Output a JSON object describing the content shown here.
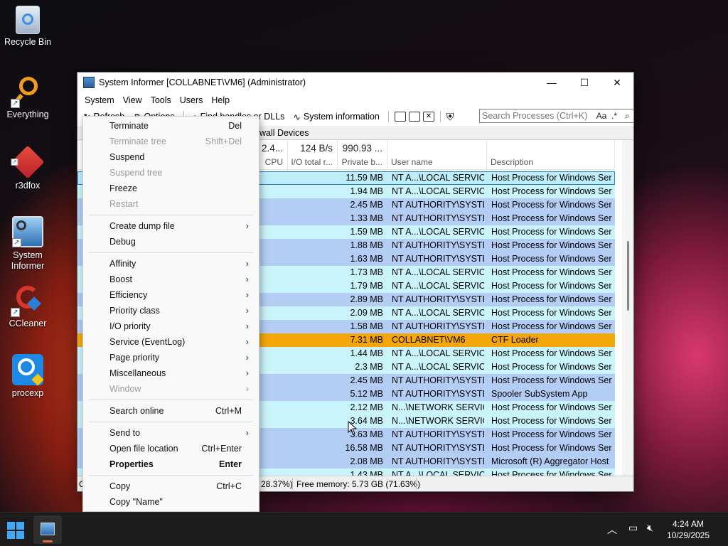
{
  "desktop": {
    "icons": [
      {
        "label": "Recycle Bin"
      },
      {
        "label": "Everything"
      },
      {
        "label": "r3dfox"
      },
      {
        "label": "System\nInformer"
      },
      {
        "label": "CCleaner"
      },
      {
        "label": "procexp"
      }
    ]
  },
  "window": {
    "title": "System Informer [COLLABNET\\VM6] (Administrator)",
    "menu": [
      "System",
      "View",
      "Tools",
      "Users",
      "Help"
    ],
    "toolbar": {
      "refresh": "Refresh",
      "options": "Options",
      "find": "Find handles or DLLs",
      "sysinfo": "System information"
    },
    "search_placeholder": "Search Processes (Ctrl+K)",
    "search_case": "Aa",
    "search_regex": ".*",
    "tabs": [
      "wall",
      "Devices"
    ],
    "columns": {
      "cpu": {
        "summary": "2.4...",
        "name": "CPU"
      },
      "io": {
        "summary": "124 B/s",
        "name": "I/O total r..."
      },
      "private": {
        "summary": "990.93 ...",
        "name": "Private b..."
      },
      "user": {
        "name": "User name"
      },
      "desc": {
        "name": "Description"
      }
    },
    "rows": [
      {
        "priv": "11.59 MB",
        "user": "NT A...\\LOCAL SERVICE",
        "desc": "Host Process for Windows Ser...",
        "bg": "#bfeefb"
      },
      {
        "priv": "1.94 MB",
        "user": "NT A...\\LOCAL SERVICE",
        "desc": "Host Process for Windows Ser...",
        "bg": "#c9f4fb"
      },
      {
        "priv": "2.45 MB",
        "user": "NT AUTHORITY\\SYSTEM",
        "desc": "Host Process for Windows Ser...",
        "bg": "#b3cdf5"
      },
      {
        "priv": "1.33 MB",
        "user": "NT AUTHORITY\\SYSTEM",
        "desc": "Host Process for Windows Ser...",
        "bg": "#b3cdf5"
      },
      {
        "priv": "1.59 MB",
        "user": "NT A...\\LOCAL SERVICE",
        "desc": "Host Process for Windows Ser...",
        "bg": "#c9f4fb"
      },
      {
        "priv": "1.88 MB",
        "user": "NT AUTHORITY\\SYSTEM",
        "desc": "Host Process for Windows Ser...",
        "bg": "#b3cdf5"
      },
      {
        "priv": "1.63 MB",
        "user": "NT AUTHORITY\\SYSTEM",
        "desc": "Host Process for Windows Ser...",
        "bg": "#b3cdf5"
      },
      {
        "priv": "1.73 MB",
        "user": "NT A...\\LOCAL SERVICE",
        "desc": "Host Process for Windows Ser...",
        "bg": "#c9f4fb"
      },
      {
        "priv": "1.79 MB",
        "user": "NT A...\\LOCAL SERVICE",
        "desc": "Host Process for Windows Ser...",
        "bg": "#c9f4fb"
      },
      {
        "priv": "2.89 MB",
        "user": "NT AUTHORITY\\SYSTEM",
        "desc": "Host Process for Windows Ser...",
        "bg": "#b3cdf5"
      },
      {
        "priv": "2.09 MB",
        "user": "NT A...\\LOCAL SERVICE",
        "desc": "Host Process for Windows Ser...",
        "bg": "#c9f4fb"
      },
      {
        "priv": "1.58 MB",
        "user": "NT AUTHORITY\\SYSTEM",
        "desc": "Host Process for Windows Ser...",
        "bg": "#b3cdf5"
      },
      {
        "priv": "7.31 MB",
        "user": "COLLABNET\\VM6",
        "desc": "CTF Loader",
        "bg": "#f5a70a"
      },
      {
        "priv": "1.44 MB",
        "user": "NT A...\\LOCAL SERVICE",
        "desc": "Host Process for Windows Ser...",
        "bg": "#c9f4fb"
      },
      {
        "priv": "2.3 MB",
        "user": "NT A...\\LOCAL SERVICE",
        "desc": "Host Process for Windows Ser...",
        "bg": "#c9f4fb"
      },
      {
        "priv": "2.45 MB",
        "user": "NT AUTHORITY\\SYSTEM",
        "desc": "Host Process for Windows Ser...",
        "bg": "#b3cdf5"
      },
      {
        "priv": "5.12 MB",
        "user": "NT AUTHORITY\\SYSTEM",
        "desc": "Spooler SubSystem App",
        "bg": "#b3cdf5"
      },
      {
        "priv": "2.12 MB",
        "user": "N...\\NETWORK SERVICE",
        "desc": "Host Process for Windows Ser...",
        "bg": "#c9f4fb"
      },
      {
        "priv": "3.64 MB",
        "user": "N...\\NETWORK SERVICE",
        "desc": "Host Process for Windows Ser...",
        "bg": "#c9f4fb"
      },
      {
        "priv": "3.63 MB",
        "user": "NT AUTHORITY\\SYSTEM",
        "desc": "Host Process for Windows Ser...",
        "bg": "#b3cdf5"
      },
      {
        "priv": "16.58 MB",
        "user": "NT AUTHORITY\\SYSTEM",
        "desc": "Host Process for Windows Ser...",
        "bg": "#b3cdf5"
      },
      {
        "priv": "2.08 MB",
        "user": "NT AUTHORITY\\SYSTEM",
        "desc": "Microsoft (R) Aggregator Host",
        "bg": "#b3cdf5"
      },
      {
        "priv": "1.43 MB",
        "user": "NT A...\\LOCAL SERVICE",
        "desc": "Host Process for Windows Ser...",
        "bg": "#c9f4fb"
      }
    ],
    "status": {
      "c_prefix": "C",
      "cpu_tail": "28.37%)",
      "free_memory": "Free memory: 5.73 GB (71.63%)"
    }
  },
  "context_menu": {
    "items": [
      {
        "label": "Terminate",
        "shortcut": "Del",
        "disabled": false,
        "submenu": false
      },
      {
        "label": "Terminate tree",
        "shortcut": "Shift+Del",
        "disabled": true,
        "submenu": false
      },
      {
        "label": "Suspend",
        "shortcut": "",
        "disabled": false,
        "submenu": false
      },
      {
        "label": "Suspend tree",
        "shortcut": "",
        "disabled": true,
        "submenu": false
      },
      {
        "label": "Freeze",
        "shortcut": "",
        "disabled": false,
        "submenu": false
      },
      {
        "label": "Restart",
        "shortcut": "",
        "disabled": true,
        "submenu": false
      },
      {
        "sep": true
      },
      {
        "label": "Create dump file",
        "shortcut": "",
        "disabled": false,
        "submenu": true
      },
      {
        "label": "Debug",
        "shortcut": "",
        "disabled": false,
        "submenu": false
      },
      {
        "sep": true
      },
      {
        "label": "Affinity",
        "shortcut": "",
        "disabled": false,
        "submenu": true
      },
      {
        "label": "Boost",
        "shortcut": "",
        "disabled": false,
        "submenu": true
      },
      {
        "label": "Efficiency",
        "shortcut": "",
        "disabled": false,
        "submenu": true
      },
      {
        "label": "Priority class",
        "shortcut": "",
        "disabled": false,
        "submenu": true
      },
      {
        "label": "I/O priority",
        "shortcut": "",
        "disabled": false,
        "submenu": true
      },
      {
        "label": "Service (EventLog)",
        "shortcut": "",
        "disabled": false,
        "submenu": true
      },
      {
        "label": "Page priority",
        "shortcut": "",
        "disabled": false,
        "submenu": true
      },
      {
        "label": "Miscellaneous",
        "shortcut": "",
        "disabled": false,
        "submenu": true
      },
      {
        "label": "Window",
        "shortcut": "",
        "disabled": true,
        "submenu": true
      },
      {
        "sep": true
      },
      {
        "label": "Search online",
        "shortcut": "Ctrl+M",
        "disabled": false,
        "submenu": false
      },
      {
        "sep": true
      },
      {
        "label": "Send to",
        "shortcut": "",
        "disabled": false,
        "submenu": true
      },
      {
        "label": "Open file location",
        "shortcut": "Ctrl+Enter",
        "disabled": false,
        "submenu": false
      },
      {
        "label": "Properties",
        "shortcut": "Enter",
        "disabled": false,
        "submenu": false,
        "bold": true
      },
      {
        "sep": true
      },
      {
        "label": "Copy",
        "shortcut": "Ctrl+C",
        "disabled": false,
        "submenu": false
      },
      {
        "label": "Copy \"Name\"",
        "shortcut": "",
        "disabled": false,
        "submenu": false
      }
    ]
  },
  "taskbar": {
    "time": "4:24 AM",
    "date": "10/29/2025"
  }
}
